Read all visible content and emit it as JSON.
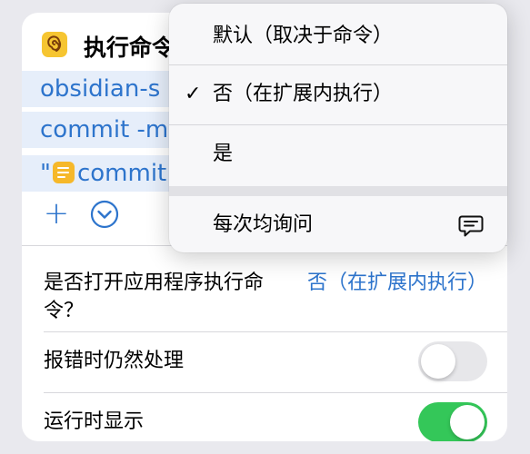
{
  "action": {
    "title": "执行命令",
    "icon": "obsidian-app-icon"
  },
  "parameters": [
    {
      "text": "obsidian-s"
    },
    {
      "text": "commit -m"
    },
    {
      "prefix": "\"",
      "variable_icon": "text-variable-icon",
      "text": "commit"
    }
  ],
  "toolbar": {
    "add_label": "+",
    "add_icon": "plus-icon",
    "more_icon": "chevron-down-circle-icon"
  },
  "settings": {
    "open_app": {
      "label": "是否打开应用程序执行命令？",
      "value": "否（在扩展内执行）"
    },
    "continue_on_error": {
      "label": "报错时仍然处理",
      "enabled": false
    },
    "show_when_run": {
      "label": "运行时显示",
      "enabled": true
    }
  },
  "menu": {
    "items": [
      {
        "label": "默认（取决于命令）",
        "selected": false
      },
      {
        "label": "否（在扩展内执行）",
        "selected": true,
        "check": "✓"
      },
      {
        "label": "是",
        "selected": false
      }
    ],
    "secondary_items": [
      {
        "label": "每次均询问",
        "icon": "message-icon"
      }
    ]
  },
  "colors": {
    "accent": "#2d74cc",
    "toggle_on": "#34c759",
    "toggle_off": "#e7e7ea",
    "app_icon_bg": "#f6c531",
    "param_bg": "#e6eefa"
  }
}
